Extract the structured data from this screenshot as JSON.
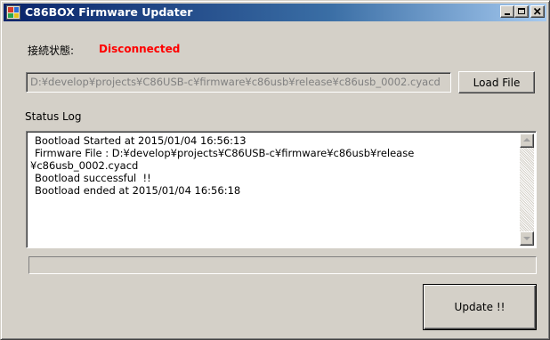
{
  "window": {
    "title": "C86BOX Firmware Updater"
  },
  "connection": {
    "label": "接続状態:",
    "status": "Disconnected",
    "status_color": "#ff0000"
  },
  "file": {
    "path": "D:¥develop¥projects¥C86USB-c¥firmware¥c86usb¥release¥c86usb_0002.cyacd",
    "load_button": "Load File"
  },
  "log": {
    "label": "Status Log",
    "lines": [
      "Bootload Started at 2015/01/04 16:56:13",
      "Firmware File : D:¥develop¥projects¥C86USB-c¥firmware¥c86usb¥release",
      "¥c86usb_0002.cyacd",
      "Bootload successful  !!",
      "Bootload ended at 2015/01/04 16:56:18"
    ]
  },
  "progress": {
    "value": 0
  },
  "actions": {
    "update_button": "Update !!"
  },
  "icons": {
    "app": "app-icon",
    "minimize": "minimize-icon",
    "maximize": "maximize-icon",
    "close": "close-icon",
    "scroll_up": "arrow-up-icon",
    "scroll_down": "arrow-down-icon"
  },
  "colors": {
    "title_gradient_start": "#0a246a",
    "title_gradient_end": "#a6caf0",
    "window_bg": "#d4d0c8"
  }
}
